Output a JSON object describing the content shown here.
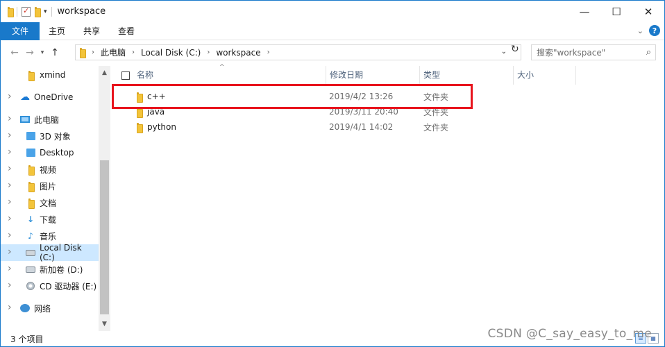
{
  "window": {
    "title": "workspace",
    "controls": {
      "minimize": "—",
      "maximize": "☐",
      "close": "✕"
    }
  },
  "ribbon": {
    "tabs": [
      "文件",
      "主页",
      "共享",
      "查看"
    ],
    "help": "?"
  },
  "address": {
    "breadcrumbs": [
      "此电脑",
      "Local Disk (C:)",
      "workspace"
    ],
    "search_placeholder": "搜索\"workspace\""
  },
  "sidebar": {
    "items": [
      {
        "label": "xmind",
        "icon": "folder-icon"
      },
      {
        "label": "OneDrive",
        "icon": "cloud-icon"
      },
      {
        "label": "此电脑",
        "icon": "computer-icon"
      },
      {
        "label": "3D 对象",
        "icon": "3d-objects-icon"
      },
      {
        "label": "Desktop",
        "icon": "desktop-icon"
      },
      {
        "label": "视频",
        "icon": "video-icon"
      },
      {
        "label": "图片",
        "icon": "pictures-icon"
      },
      {
        "label": "文档",
        "icon": "documents-icon"
      },
      {
        "label": "下载",
        "icon": "download-icon"
      },
      {
        "label": "音乐",
        "icon": "music-icon"
      },
      {
        "label": "Local Disk (C:)",
        "icon": "local-disk-icon",
        "selected": true
      },
      {
        "label": "新加卷 (D:)",
        "icon": "disk-icon"
      },
      {
        "label": "CD 驱动器 (E:)",
        "icon": "cd-drive-icon"
      },
      {
        "label": "网络",
        "icon": "network-icon"
      }
    ]
  },
  "columns": {
    "name": "名称",
    "date": "修改日期",
    "type": "类型",
    "size": "大小"
  },
  "files": [
    {
      "name": "c++",
      "date": "2019/4/2 13:26",
      "type": "文件夹",
      "highlighted": true
    },
    {
      "name": "java",
      "date": "2019/3/11 20:40",
      "type": "文件夹"
    },
    {
      "name": "python",
      "date": "2019/4/1 14:02",
      "type": "文件夹"
    }
  ],
  "status": {
    "item_count": "3 个项目"
  },
  "watermark": "CSDN @C_say_easy_to_me",
  "colors": {
    "accent": "#1979ca",
    "selection": "#cde8ff",
    "highlight_border": "#e8141d",
    "folder": "#f3c43a"
  }
}
